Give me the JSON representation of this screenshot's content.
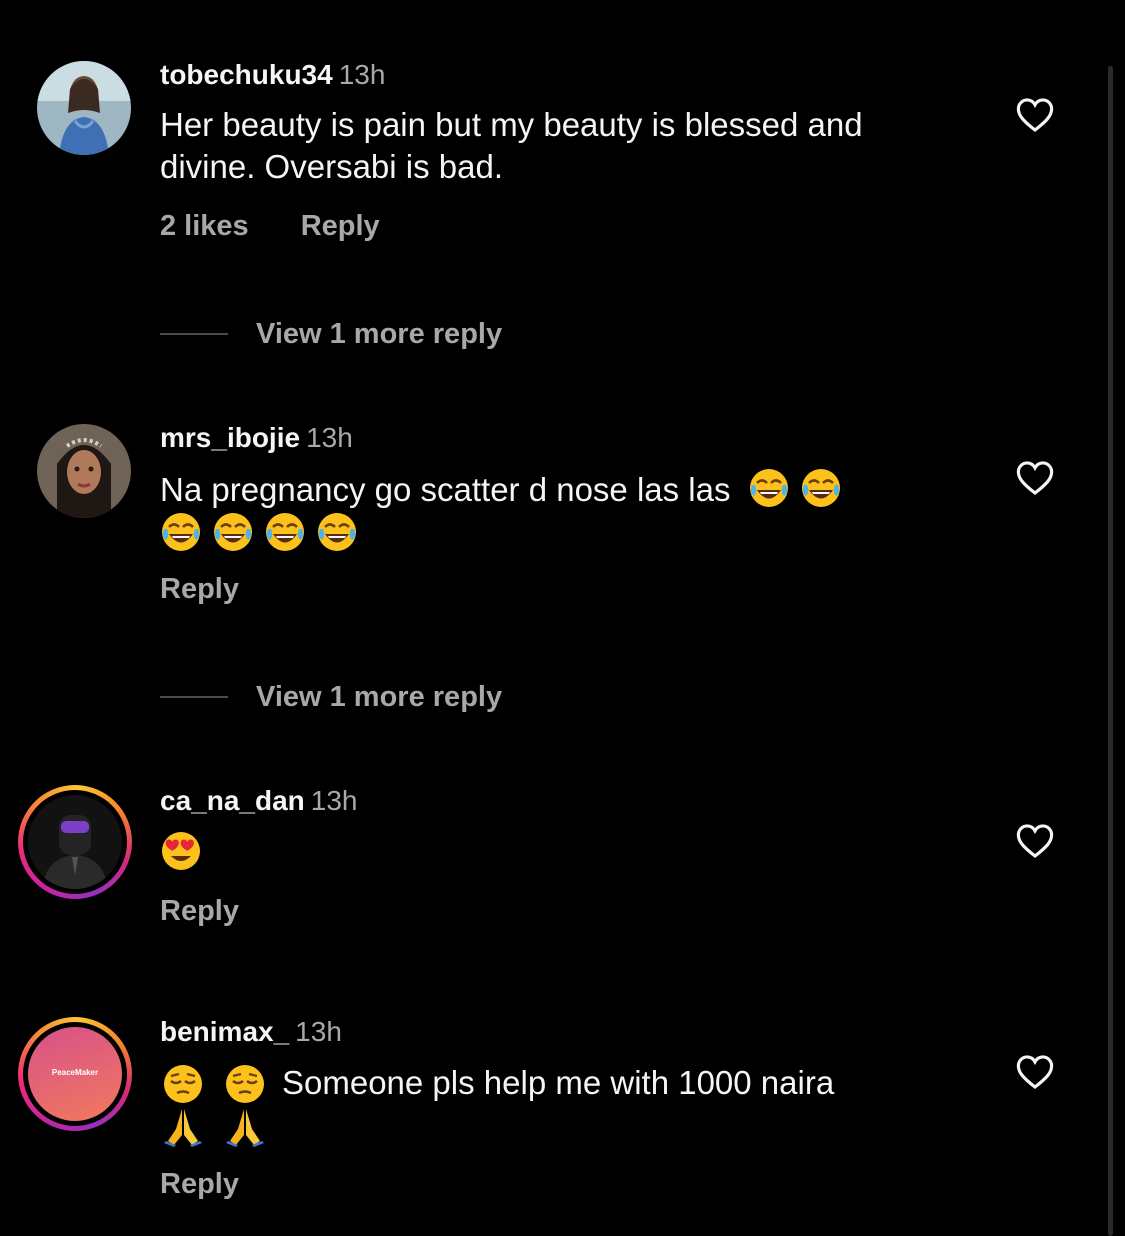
{
  "comments": [
    {
      "username": "tobechuku34",
      "time": "13h",
      "text": "Her beauty is pain but my beauty is blessed and divine. Oversabi is bad.",
      "likes": "2 likes",
      "reply": "Reply",
      "view_more": "View 1 more reply"
    },
    {
      "username": "mrs_ibojie",
      "time": "13h",
      "text": "Na pregnancy go scatter d nose las las",
      "emojis": [
        "face-with-tears-of-joy",
        "face-with-tears-of-joy",
        "face-with-tears-of-joy",
        "face-with-tears-of-joy",
        "face-with-tears-of-joy",
        "face-with-tears-of-joy"
      ],
      "reply": "Reply",
      "view_more": "View 1 more reply"
    },
    {
      "username": "ca_na_dan",
      "time": "13h",
      "emojis": [
        "smiling-face-with-heart-eyes"
      ],
      "reply": "Reply"
    },
    {
      "username": "benimax_",
      "time": "13h",
      "avatar_text": "PeaceMaker",
      "text": "Someone pls help me with 1000 naira",
      "emojis": [
        "pensive-face",
        "pensive-face",
        "folded-hands",
        "folded-hands"
      ],
      "reply": "Reply"
    }
  ],
  "colors": {
    "background": "#000000",
    "primary_text": "#f5f5f5",
    "secondary_text": "#a8a8a8",
    "story_ring": "#d62976"
  },
  "icons": {
    "like": "heart-outline-icon"
  }
}
